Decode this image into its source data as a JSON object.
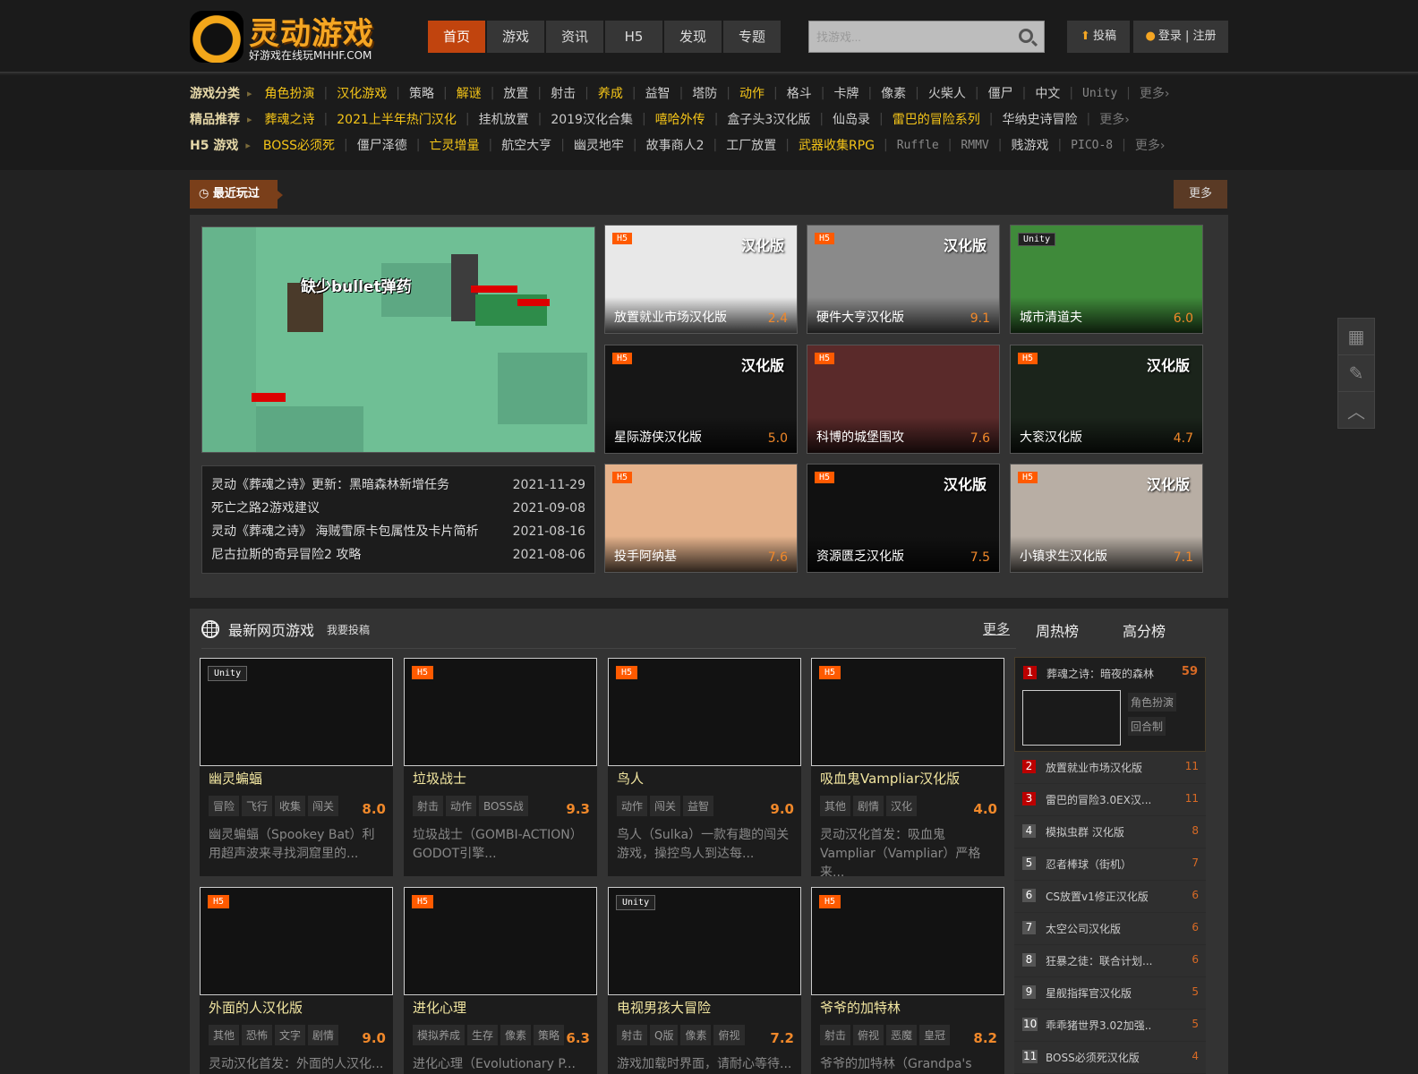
{
  "header": {
    "logo_title": "灵动游戏",
    "logo_sub": "好游戏在线玩MHHF.COM",
    "nav": [
      "首页",
      "游戏",
      "资讯",
      "H5",
      "发现",
      "专题"
    ],
    "search_placeholder": "找游戏...",
    "submit": "投稿",
    "login": "登录 | 注册"
  },
  "categories": [
    {
      "label": "游戏分类",
      "items": [
        [
          "角色扮演",
          "hl"
        ],
        [
          "汉化游戏",
          "hl"
        ],
        [
          "策略",
          ""
        ],
        [
          "解谜",
          "hl"
        ],
        [
          "放置",
          ""
        ],
        [
          "射击",
          ""
        ],
        [
          "养成",
          "hl"
        ],
        [
          "益智",
          ""
        ],
        [
          "塔防",
          ""
        ],
        [
          "动作",
          "hl"
        ],
        [
          "格斗",
          ""
        ],
        [
          "卡牌",
          ""
        ],
        [
          "像素",
          ""
        ],
        [
          "火柴人",
          ""
        ],
        [
          "僵尸",
          ""
        ],
        [
          "中文",
          ""
        ],
        [
          "Unity",
          "dim"
        ],
        [
          "更多›",
          "more"
        ]
      ]
    },
    {
      "label": "精品推荐",
      "items": [
        [
          "葬魂之诗",
          "hl"
        ],
        [
          "2021上半年热门汉化",
          "hl"
        ],
        [
          "挂机放置",
          ""
        ],
        [
          "2019汉化合集",
          ""
        ],
        [
          "嘻哈外传",
          "hl"
        ],
        [
          "盒子头3汉化版",
          ""
        ],
        [
          "仙岛录",
          ""
        ],
        [
          "雷巴的冒险系列",
          "hl"
        ],
        [
          "华纳史诗冒险",
          ""
        ],
        [
          "更多›",
          "more"
        ]
      ]
    },
    {
      "label": "H5 游戏",
      "items": [
        [
          "BOSS必须死",
          "hl"
        ],
        [
          "僵尸泽德",
          ""
        ],
        [
          "亡灵增量",
          "hl"
        ],
        [
          "航空大亨",
          ""
        ],
        [
          "幽灵地牢",
          ""
        ],
        [
          "故事商人2",
          ""
        ],
        [
          "工厂放置",
          ""
        ],
        [
          "武器收集RPG",
          "hl"
        ],
        [
          "Ruffle",
          "dim"
        ],
        [
          "RMMV",
          "dim"
        ],
        [
          "贱游戏",
          ""
        ],
        [
          "PICO-8",
          "dim"
        ],
        [
          "更多›",
          "more"
        ]
      ]
    }
  ],
  "recent": {
    "tag": "最近玩过",
    "more": "更多",
    "hero_caption": "缺少bullet弹药",
    "news": [
      {
        "title": "灵动《葬魂之诗》更新：黑暗森林新增任务",
        "date": "2021-11-29"
      },
      {
        "title": "死亡之路2游戏建议",
        "date": "2021-09-08"
      },
      {
        "title": "灵动《葬魂之诗》 海贼雪原卡包属性及卡片简析",
        "date": "2021-08-16"
      },
      {
        "title": "尼古拉斯的奇异冒险2 攻略",
        "date": "2021-08-06"
      }
    ],
    "tiles": [
      {
        "name": "放置就业市场汉化版",
        "score": "2.4",
        "badge": "H5",
        "hz": "汉化版",
        "bg": "#e8e8e8"
      },
      {
        "name": "硬件大亨汉化版",
        "score": "9.1",
        "badge": "H5",
        "hz": "汉化版",
        "bg": "#8a8a8a"
      },
      {
        "name": "城市清道夫",
        "score": "6.0",
        "badge": "Unity",
        "hz": "",
        "bg": "#3f8a3a"
      },
      {
        "name": "星际游侠汉化版",
        "score": "5.0",
        "badge": "H5",
        "hz": "汉化版",
        "bg": "#161616"
      },
      {
        "name": "科博的城堡围攻",
        "score": "7.6",
        "badge": "H5",
        "hz": "",
        "bg": "#5a2a2a"
      },
      {
        "name": "大衮汉化版",
        "score": "4.7",
        "badge": "H5",
        "hz": "汉化版",
        "bg": "#1b241b"
      },
      {
        "name": "投手阿纳基",
        "score": "7.6",
        "badge": "H5",
        "hz": "",
        "bg": "#e6b38c"
      },
      {
        "name": "资源匮乏汉化版",
        "score": "7.5",
        "badge": "H5",
        "hz": "汉化版",
        "bg": "#111"
      },
      {
        "name": "小镇求生汉化版",
        "score": "7.1",
        "badge": "H5",
        "hz": "汉化版",
        "bg": "#b8aea4"
      }
    ]
  },
  "latest": {
    "title": "最新网页游戏",
    "submit": "我要投稿",
    "more": "更多",
    "tab_week": "周热榜",
    "tab_score": "高分榜",
    "cards": [
      {
        "badge": "Unity",
        "name": "幽灵蝙蝠",
        "tags": [
          "冒险",
          "飞行",
          "收集",
          "闯关"
        ],
        "score": "8.0",
        "desc": "幽灵蝙蝠（Spookey Bat）利用超声波来寻找洞窟里的..."
      },
      {
        "badge": "H5",
        "name": "垃圾战士",
        "tags": [
          "射击",
          "动作",
          "BOSS战"
        ],
        "score": "9.3",
        "desc": "垃圾战士（GOMBI-ACTION）GODOT引擎..."
      },
      {
        "badge": "H5",
        "name": "鸟人",
        "tags": [
          "动作",
          "闯关",
          "益智"
        ],
        "score": "9.0",
        "desc": "鸟人（Sulka）一款有趣的闯关游戏，操控鸟人到达每..."
      },
      {
        "badge": "H5",
        "name": "吸血鬼Vampliar汉化版",
        "tags": [
          "其他",
          "剧情",
          "汉化"
        ],
        "score": "4.0",
        "desc": "灵动汉化首发：吸血鬼Vampliar（Vampliar）严格来..."
      },
      {
        "badge": "H5",
        "name": "外面的人汉化版",
        "tags": [
          "其他",
          "恐怖",
          "文字",
          "剧情"
        ],
        "score": "9.0",
        "desc": "灵动汉化首发：外面的人汉化..."
      },
      {
        "badge": "H5",
        "name": "进化心理",
        "tags": [
          "模拟养成",
          "生存",
          "像素",
          "策略"
        ],
        "score": "6.3",
        "desc": "进化心理（Evolutionary P..."
      },
      {
        "badge": "Unity",
        "name": "电视男孩大冒险",
        "tags": [
          "射击",
          "Q版",
          "像素",
          "俯视"
        ],
        "score": "7.2",
        "desc": "游戏加载时界面，请耐心等待..."
      },
      {
        "badge": "H5",
        "name": "爷爷的加特林",
        "tags": [
          "射击",
          "俯视",
          "恶魔",
          "皇冠"
        ],
        "score": "8.2",
        "desc": "爷爷的加特林（Grandpa's Mi..."
      }
    ],
    "rank": {
      "first": {
        "num": "1",
        "name": "葬魂之诗：暗夜的森林",
        "score": "59",
        "tags": [
          "角色扮演",
          "回合制"
        ]
      },
      "items": [
        [
          "2",
          "放置就业市场汉化版",
          "11"
        ],
        [
          "3",
          "雷巴的冒险3.0EX汉...",
          "11"
        ],
        [
          "4",
          "模拟虫群 汉化版",
          "8"
        ],
        [
          "5",
          "忍者棒球（街机）",
          "7"
        ],
        [
          "6",
          "CS放置v1修正汉化版",
          "6"
        ],
        [
          "7",
          "太空公司汉化版",
          "6"
        ],
        [
          "8",
          "狂暴之徒：联合计划...",
          "6"
        ],
        [
          "9",
          "星舰指挥官汉化版",
          "5"
        ],
        [
          "10",
          "乖乖猪世界3.02加强..",
          "5"
        ],
        [
          "11",
          "BOSS必须死汉化版",
          "4"
        ]
      ]
    }
  }
}
